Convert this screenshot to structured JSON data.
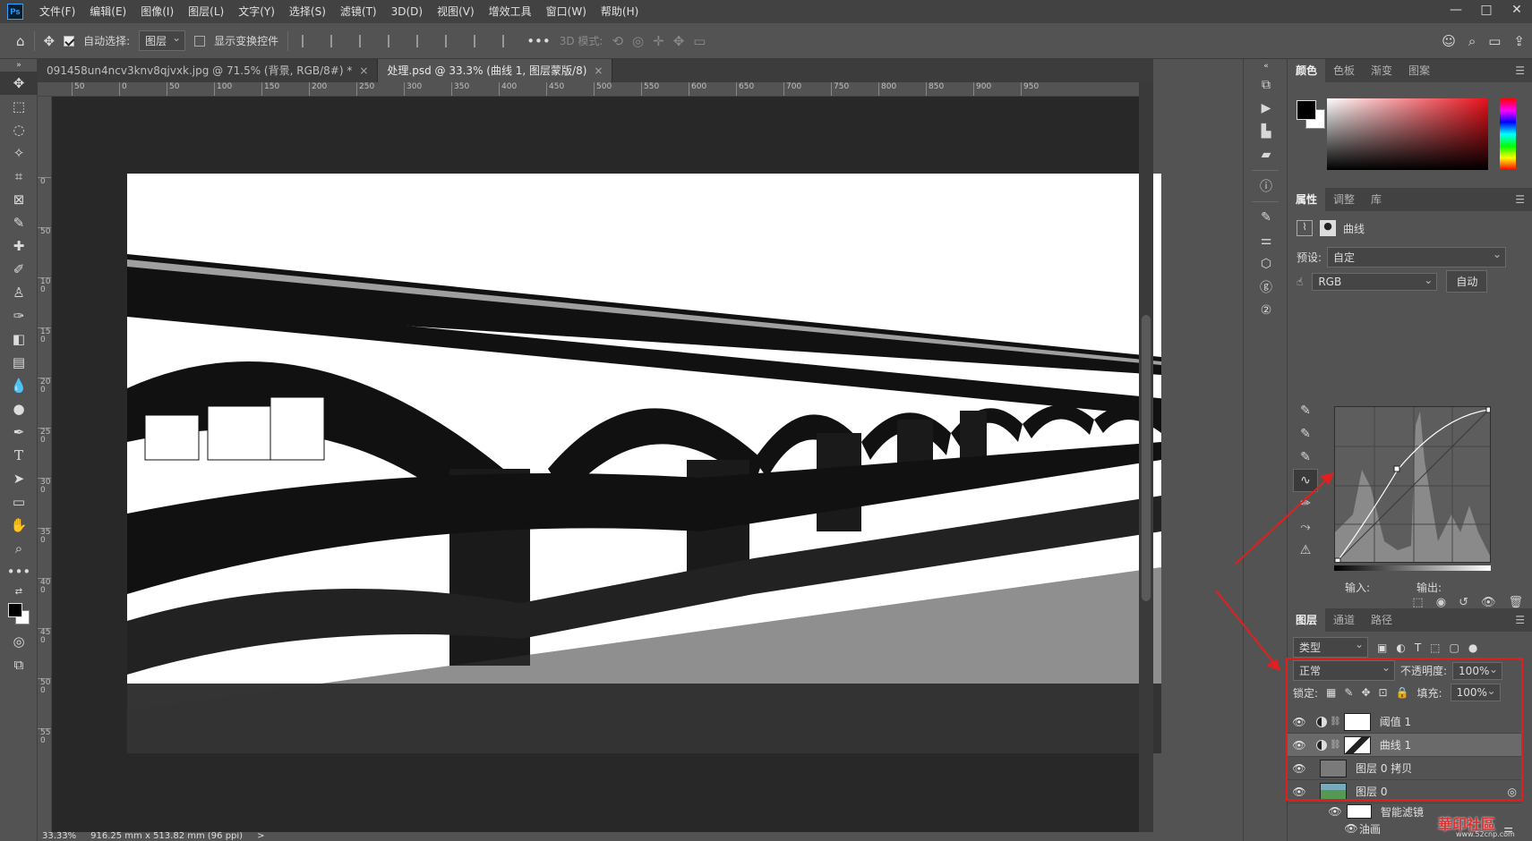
{
  "app": {
    "logo": "Ps"
  },
  "menu": [
    "文件(F)",
    "编辑(E)",
    "图像(I)",
    "图层(L)",
    "文字(Y)",
    "选择(S)",
    "滤镜(T)",
    "3D(D)",
    "视图(V)",
    "增效工具",
    "窗口(W)",
    "帮助(H)"
  ],
  "window_controls": {
    "minimize": "—",
    "maximize": "□",
    "close": "✕"
  },
  "options": {
    "auto_select_label": "自动选择:",
    "auto_select_target": "图层",
    "show_transform_label": "显示变换控件",
    "more": "•••",
    "mode_3d_label": "3D 模式:"
  },
  "tabs": [
    {
      "label": "091458un4ncv3knv8qjvxk.jpg @ 71.5% (背景, RGB/8#) *",
      "close": "×"
    },
    {
      "label": "处理.psd @ 33.3% (曲线 1, 图层蒙版/8)",
      "close": "×"
    }
  ],
  "ruler_h": [
    "50",
    "0",
    "50",
    "100",
    "150",
    "200",
    "250",
    "300",
    "350",
    "400",
    "450",
    "500",
    "550",
    "600",
    "650",
    "700",
    "750",
    "800",
    "850",
    "900",
    "950"
  ],
  "ruler_v": [
    "0",
    "50",
    "100",
    "150",
    "200",
    "250",
    "300",
    "350",
    "400",
    "450",
    "500",
    "550"
  ],
  "status": {
    "zoom": "33.33%",
    "doc_size": "916.25 mm x 513.82 mm (96 ppi)",
    "arrow": ">"
  },
  "color_panel": {
    "tabs": [
      "颜色",
      "色板",
      "渐变",
      "图案"
    ],
    "fg_color": "#000000",
    "bg_color": "#ffffff"
  },
  "properties_panel": {
    "tabs": [
      "属性",
      "调整",
      "库"
    ],
    "title": "曲线",
    "preset_label": "预设:",
    "preset_value": "自定",
    "channel_value": "RGB",
    "auto_button": "自动",
    "input_label": "输入:",
    "output_label": "输出:"
  },
  "layers_panel": {
    "tabs": [
      "图层",
      "通道",
      "路径"
    ],
    "filter_value": "类型",
    "blend_mode": "正常",
    "opacity_label": "不透明度:",
    "opacity_value": "100%",
    "lock_label": "锁定:",
    "fill_label": "填充:",
    "fill_value": "100%",
    "layers": [
      {
        "name": "阈值 1"
      },
      {
        "name": "曲线 1"
      },
      {
        "name": "图层 0 拷贝"
      },
      {
        "name": "图层 0"
      },
      {
        "name": "智能滤镜"
      },
      {
        "name": "油画"
      }
    ]
  },
  "watermark": {
    "text": "華印社區",
    "url": "www.52cnp.com"
  }
}
